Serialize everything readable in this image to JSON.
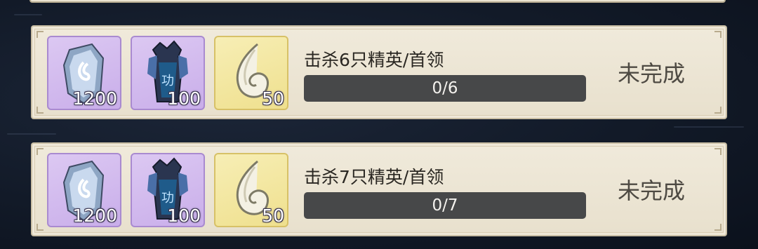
{
  "tasks": [
    {
      "title": "击杀6只精英/首领",
      "progress_label": "0/6",
      "progress_fraction": 0,
      "status": "未完成",
      "rewards": [
        {
          "icon": "spirit-stone-icon",
          "qty": "1200",
          "rarity": "purple"
        },
        {
          "icon": "dark-armor-icon",
          "qty": "100",
          "rarity": "purple"
        },
        {
          "icon": "white-jade-icon",
          "qty": "50",
          "rarity": "gold"
        }
      ]
    },
    {
      "title": "击杀7只精英/首领",
      "progress_label": "0/7",
      "progress_fraction": 0,
      "status": "未完成",
      "rewards": [
        {
          "icon": "spirit-stone-icon",
          "qty": "1200",
          "rarity": "purple"
        },
        {
          "icon": "dark-armor-icon",
          "qty": "100",
          "rarity": "purple"
        },
        {
          "icon": "white-jade-icon",
          "qty": "50",
          "rarity": "gold"
        }
      ]
    }
  ],
  "colors": {
    "card_bg": "#ece5d4",
    "purple_frame": "#c9aeea",
    "gold_frame": "#efe08e",
    "progress_track": "#474849"
  }
}
